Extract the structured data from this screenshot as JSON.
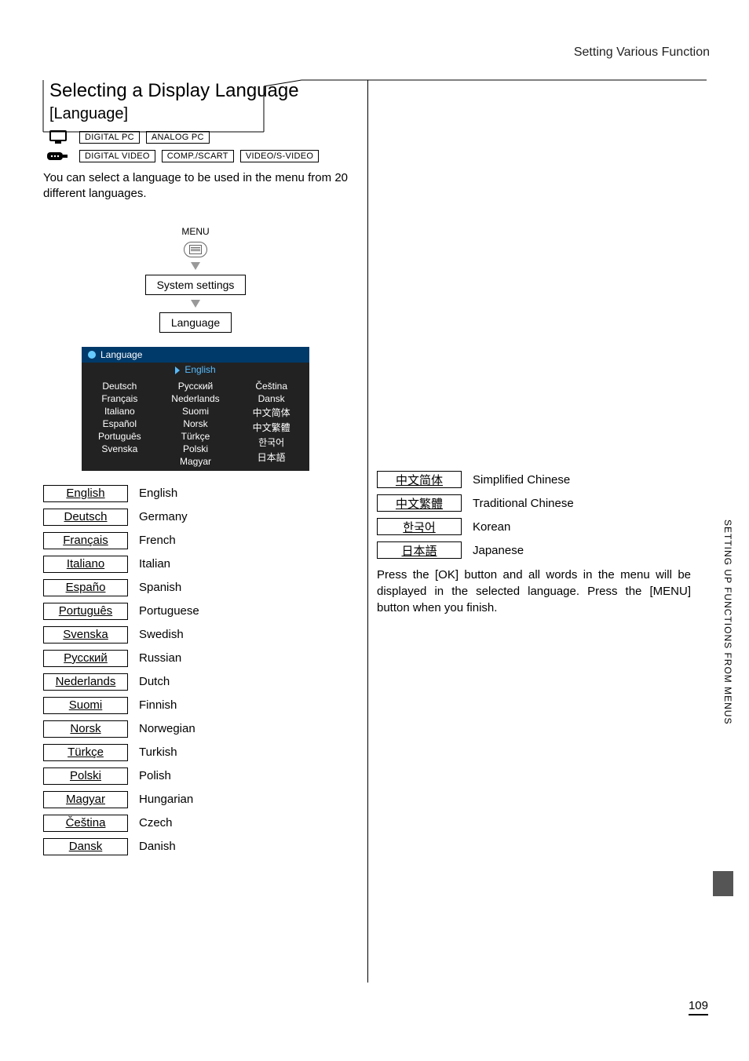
{
  "header": {
    "running": "Setting Various Function"
  },
  "section": {
    "title": "Selecting a Display Language",
    "subtitle": "[Language]"
  },
  "badges": {
    "row1": {
      "a": "DIGITAL PC",
      "b": "ANALOG PC"
    },
    "row2": {
      "a": "DIGITAL VIDEO",
      "b": "COMP./SCART",
      "c": "VIDEO/S-VIDEO"
    }
  },
  "intro": "You can select a language to be used in the menu from 20 different languages.",
  "menuflow": {
    "menu_label": "MENU",
    "step1": "System settings",
    "step2": "Language"
  },
  "osd": {
    "header": "Language",
    "col1": [
      "English",
      "Deutsch",
      "Français",
      "Italiano",
      "Español",
      "Português",
      "Svenska"
    ],
    "col2": [
      "Русский",
      "Nederlands",
      "Suomi",
      "Norsk",
      "Türkçe",
      "Polski",
      "Magyar"
    ],
    "col3": [
      "Čeština",
      "Dansk",
      "中文简体",
      "中文繁體",
      "한국어",
      "日本語"
    ]
  },
  "langs_left": [
    {
      "btn": "English",
      "desc": "English"
    },
    {
      "btn": "Deutsch",
      "desc": "Germany"
    },
    {
      "btn": "Français",
      "desc": "French"
    },
    {
      "btn": "Italiano",
      "desc": "Italian"
    },
    {
      "btn": "Españo",
      "desc": "Spanish"
    },
    {
      "btn": "Português",
      "desc": "Portuguese"
    },
    {
      "btn": "Svenska",
      "desc": "Swedish"
    },
    {
      "btn": "Русский",
      "desc": "Russian"
    },
    {
      "btn": "Nederlands",
      "desc": "Dutch"
    },
    {
      "btn": "Suomi",
      "desc": "Finnish"
    },
    {
      "btn": "Norsk",
      "desc": "Norwegian"
    },
    {
      "btn": "Türkçe",
      "desc": "Turkish"
    },
    {
      "btn": "Polski",
      "desc": "Polish"
    },
    {
      "btn": "Magyar",
      "desc": "Hungarian"
    },
    {
      "btn": "Čeština",
      "desc": "Czech"
    },
    {
      "btn": "Dansk",
      "desc": "Danish"
    }
  ],
  "langs_right": [
    {
      "btn": "中文简体",
      "desc": "Simplified Chinese"
    },
    {
      "btn": "中文繁體",
      "desc": "Traditional Chinese"
    },
    {
      "btn": "한국어",
      "desc": "Korean"
    },
    {
      "btn": "日本語",
      "desc": "Japanese"
    }
  ],
  "right_para": "Press the [OK] button and all words in the menu will be displayed in the selected language. Press the [MENU] button when you finish.",
  "side_label": "SETTING UP FUNCTIONS FROM MENUS",
  "page_number": "109"
}
